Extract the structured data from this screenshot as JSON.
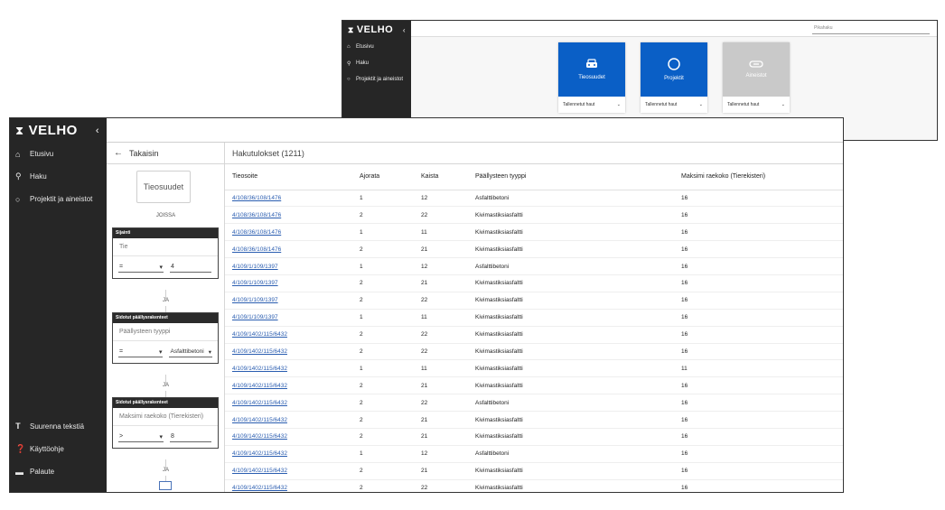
{
  "back_window": {
    "brand": "VELHO",
    "collapse_icon": "chevron-left-icon",
    "nav": [
      {
        "label": "Etusivu",
        "icon": "home-icon"
      },
      {
        "label": "Haku",
        "icon": "search-icon"
      },
      {
        "label": "Projektit ja aineistot",
        "icon": "circle-icon"
      }
    ],
    "quick_search_placeholder": "Pikahaku",
    "tiles": [
      {
        "label": "Tieosuudet",
        "icon": "car-icon",
        "color": "#0a5fc6",
        "dropdown": "Tallennetut haut"
      },
      {
        "label": "Projektit",
        "icon": "circle-icon",
        "color": "#0a5fc6",
        "dropdown": "Tallennetut haut"
      },
      {
        "label": "Aineistot",
        "icon": "attachment-icon",
        "color": "#c9c9c9",
        "dropdown": "Tallennetut haut"
      }
    ]
  },
  "front_window": {
    "brand": "VELHO",
    "nav": [
      {
        "label": "Etusivu",
        "icon": "home-icon"
      },
      {
        "label": "Haku",
        "icon": "search-icon"
      },
      {
        "label": "Projektit ja aineistot",
        "icon": "circle-icon"
      }
    ],
    "bottom_nav": [
      {
        "label": "Suurenna tekstiä",
        "icon": "text-size-icon"
      },
      {
        "label": "Käyttöohje",
        "icon": "help-icon"
      },
      {
        "label": "Palaute",
        "icon": "feedback-icon"
      }
    ],
    "filter": {
      "back_label": "Takaisin",
      "source": "Tieosuudet",
      "joissa": "JOISSA",
      "ja": "JA",
      "cards": [
        {
          "title": "Sijainti",
          "field": "Tie",
          "operator": "=",
          "value": "4"
        },
        {
          "title": "Sidotut päällysrakenteet",
          "field": "Päällysteen tyyppi",
          "operator": "=",
          "value": "Asfalttibetoni"
        },
        {
          "title": "Sidotut päällysrakenteet",
          "field": "Maksimi raekoko (Tierekisteri)",
          "operator": ">",
          "value": "8"
        }
      ]
    },
    "results": {
      "title": "Hakutulokset (1211)",
      "columns": [
        "Tieosoite",
        "Ajorata",
        "Kaista",
        "Päällysteen tyyppi",
        "Maksimi raekoko (Tierekisteri)"
      ],
      "rows": [
        [
          "4/108/36/108/1476",
          "1",
          "12",
          "Asfalttibetoni",
          "16"
        ],
        [
          "4/108/36/108/1476",
          "2",
          "22",
          "Kivimastiksiasfaltti",
          "16"
        ],
        [
          "4/108/36/108/1476",
          "1",
          "11",
          "Kivimastiksiasfaltti",
          "16"
        ],
        [
          "4/108/36/108/1476",
          "2",
          "21",
          "Kivimastiksiasfaltti",
          "16"
        ],
        [
          "4/109/1/109/1397",
          "1",
          "12",
          "Asfalttibetoni",
          "16"
        ],
        [
          "4/109/1/109/1397",
          "2",
          "21",
          "Kivimastiksiasfaltti",
          "16"
        ],
        [
          "4/109/1/109/1397",
          "2",
          "22",
          "Kivimastiksiasfaltti",
          "16"
        ],
        [
          "4/109/1/109/1397",
          "1",
          "11",
          "Kivimastiksiasfaltti",
          "16"
        ],
        [
          "4/109/1402/115/6432",
          "2",
          "22",
          "Kivimastiksiasfaltti",
          "16"
        ],
        [
          "4/109/1402/115/6432",
          "2",
          "22",
          "Kivimastiksiasfaltti",
          "16"
        ],
        [
          "4/109/1402/115/6432",
          "1",
          "11",
          "Kivimastiksiasfaltti",
          "11"
        ],
        [
          "4/109/1402/115/6432",
          "2",
          "21",
          "Kivimastiksiasfaltti",
          "16"
        ],
        [
          "4/109/1402/115/6432",
          "2",
          "22",
          "Asfalttibetoni",
          "16"
        ],
        [
          "4/109/1402/115/6432",
          "2",
          "21",
          "Kivimastiksiasfaltti",
          "16"
        ],
        [
          "4/109/1402/115/6432",
          "2",
          "21",
          "Kivimastiksiasfaltti",
          "16"
        ],
        [
          "4/109/1402/115/6432",
          "1",
          "12",
          "Asfalttibetoni",
          "16"
        ],
        [
          "4/109/1402/115/6432",
          "2",
          "21",
          "Kivimastiksiasfaltti",
          "16"
        ],
        [
          "4/109/1402/115/6432",
          "2",
          "22",
          "Kivimastiksiasfaltti",
          "16"
        ]
      ]
    }
  }
}
